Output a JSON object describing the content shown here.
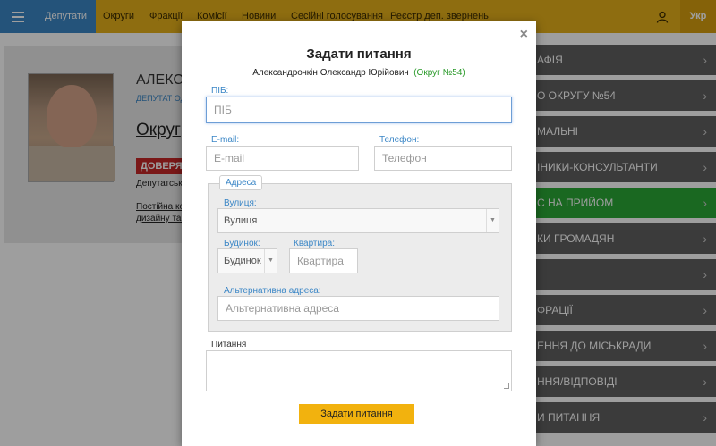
{
  "nav": {
    "items": [
      "Депутати",
      "Округи",
      "Фракції",
      "Комісії",
      "Новини",
      "Сесійні голосування",
      "Реєстр деп. звернень"
    ],
    "lang": "Укр"
  },
  "profile": {
    "name": "АЛЕКС",
    "subtitle": "ДЕПУТАТ ОД",
    "okrug": "Округ",
    "badge": "ДОВЕРЯЙ",
    "line1": "Депутатськ",
    "line2": "Постійна ком",
    "line3": "дизайну та а"
  },
  "side_menu": [
    {
      "label": "АФІЯ"
    },
    {
      "label": "О ОКРУГУ №54"
    },
    {
      "label": "МАЛЬНІ"
    },
    {
      "label": "ІНИКИ-КОНСУЛЬТАНТИ"
    },
    {
      "label": "С НА ПРИЙОМ",
      "active": true
    },
    {
      "label": "КИ ГРОМАДЯН"
    },
    {
      "label": ""
    },
    {
      "label": "ФРАЦІЇ"
    },
    {
      "label": "ЕННЯ ДО МІСЬКРАДИ"
    },
    {
      "label": "ННЯ/ВІДПОВІДІ"
    },
    {
      "label": "И ПИТАННЯ"
    }
  ],
  "modal": {
    "close": "×",
    "title": "Задати питання",
    "deputy": "Александрочкін Олександр Юрійович",
    "okrug": "(Округ №54)",
    "pib_label": "ПІБ:",
    "pib_placeholder": "ПІБ",
    "email_label": "E-mail:",
    "email_placeholder": "E-mail",
    "phone_label": "Телефон:",
    "phone_placeholder": "Телефон",
    "address_legend": "Адреса",
    "street_label": "Вулиця:",
    "street_value": "Вулиця",
    "house_label": "Будинок:",
    "house_value": "Будинок",
    "apt_label": "Квартира:",
    "apt_placeholder": "Квартира",
    "alt_label": "Альтернативна адреса:",
    "alt_placeholder": "Альтернативна адреса",
    "question_label": "Питання",
    "submit": "Задати питання"
  }
}
